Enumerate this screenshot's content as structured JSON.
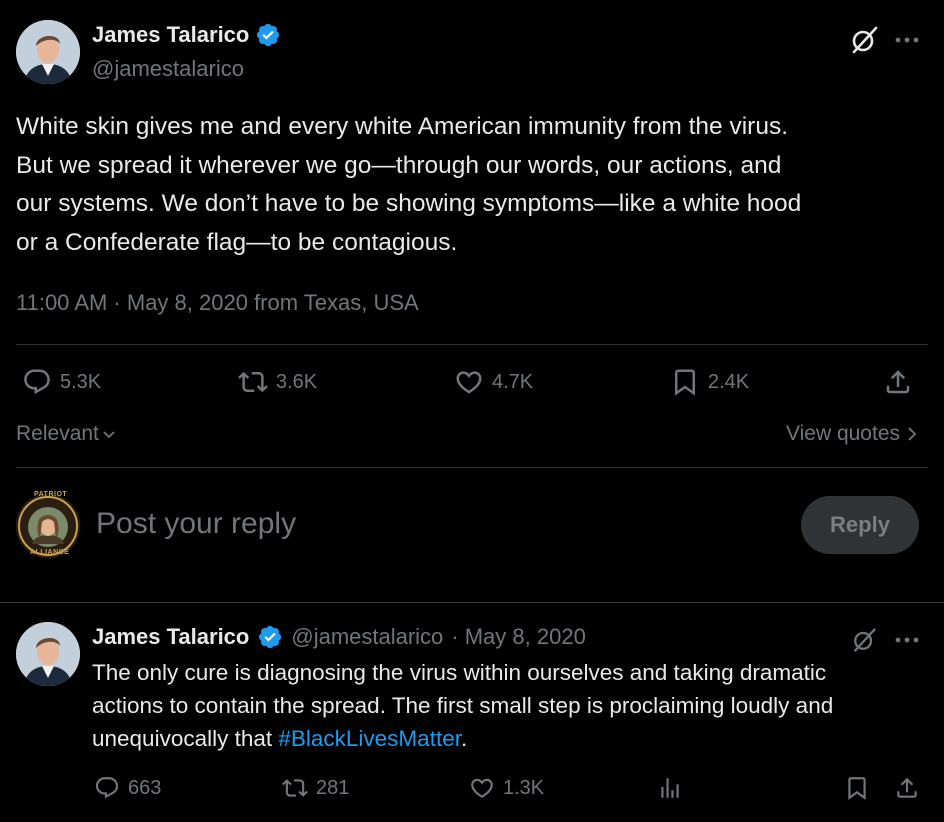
{
  "main_tweet": {
    "author_name": "James Talarico",
    "author_handle": "@jamestalarico",
    "text_lines": [
      "White skin gives me and every white American immunity from the virus.",
      "But we spread it wherever we go—through our words, our actions, and",
      "our systems. We don’t have to be showing symptoms—like a white hood",
      "or a Confederate flag—to be contagious."
    ],
    "timestamp": "11:00 AM · May 8, 2020 from Texas, USA",
    "stats": {
      "replies": "5.3K",
      "retweets": "3.6K",
      "likes": "4.7K",
      "bookmarks": "2.4K"
    }
  },
  "sort": {
    "relevant_label": "Relevant",
    "view_quotes_label": "View quotes"
  },
  "composer": {
    "placeholder": "Post your reply",
    "reply_button": "Reply",
    "avatar_badge_top": "PATRIOT",
    "avatar_badge_bottom": "ALLIANCE"
  },
  "reply_tweet": {
    "author_name": "James Talarico",
    "author_handle": "@jamestalarico",
    "date": "· May 8, 2020",
    "text_line1": "The only cure is diagnosing the virus within ourselves and taking dramatic",
    "text_line2": "actions to contain the spread. The first small step is proclaiming loudly and",
    "text_line3_prefix": "unequivocally that ",
    "hashtag": "#BlackLivesMatter",
    "text_line3_suffix": ".",
    "stats": {
      "replies": "663",
      "retweets": "281",
      "likes": "1.3K"
    }
  },
  "colors": {
    "background": "#000000",
    "text": "#e7e9ea",
    "muted": "#71767b",
    "accent": "#1d9bf0",
    "divider": "#2f3336"
  }
}
